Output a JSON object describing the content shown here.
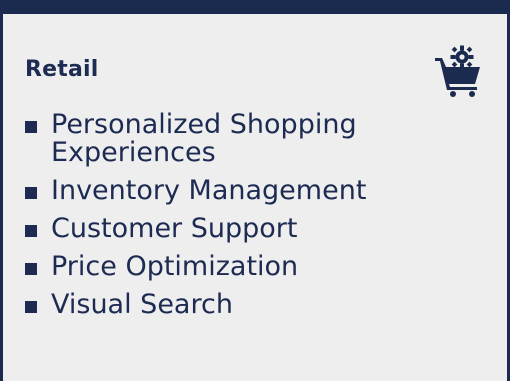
{
  "card": {
    "title": "Retail",
    "icon": "shopping-cart-gear-icon",
    "accent_color": "#1b2a4f",
    "items": [
      {
        "label": "Personalized Shopping Experiences"
      },
      {
        "label": "Inventory Management"
      },
      {
        "label": "Customer Support"
      },
      {
        "label": "Price Optimization"
      },
      {
        "label": "Visual Search"
      }
    ]
  }
}
